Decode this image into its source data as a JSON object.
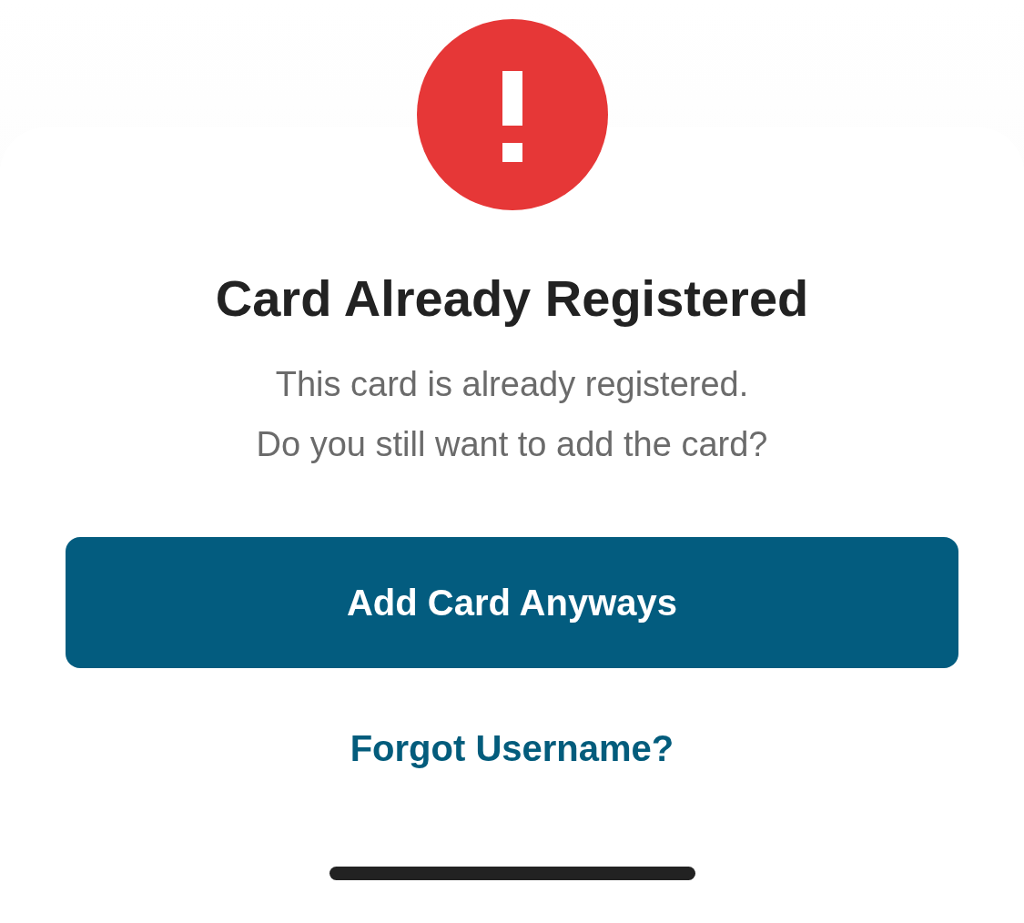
{
  "dialog": {
    "title": "Card Already Registered",
    "message": [
      "This card is already registered.",
      "Do you still want to add the card?"
    ],
    "primary_button": "Add Card Anyways",
    "link": "Forgot Username?"
  }
}
